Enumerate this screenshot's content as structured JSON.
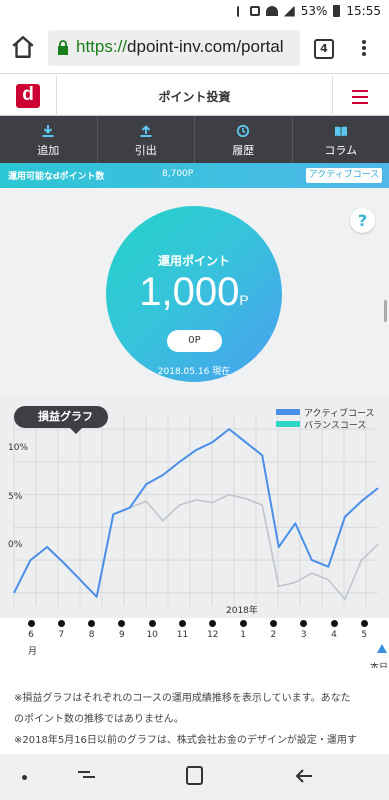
{
  "status_bar": {
    "battery": "53%",
    "time": "15:55"
  },
  "browser": {
    "url_scheme": "https://",
    "url_host": "dpoint-inv.com/portal",
    "tab_count": "4"
  },
  "app": {
    "logo": "d",
    "title": "ポイント投資",
    "brand_color": "#cc0033"
  },
  "nav": [
    {
      "label": "追加",
      "icon": "download-icon"
    },
    {
      "label": "引出",
      "icon": "upload-icon"
    },
    {
      "label": "履歴",
      "icon": "history-icon"
    },
    {
      "label": "コラム",
      "icon": "book-icon"
    }
  ],
  "points_bar": {
    "label": "運用可能なdポイント数",
    "value": "8,700P",
    "course": "アクティブコース"
  },
  "summary": {
    "label": "運用ポイント",
    "value": "1,000",
    "unit": "P",
    "change": "0P",
    "date": "2018.05.16 現在"
  },
  "graph": {
    "tag": "損益グラフ",
    "year": "2018年",
    "month_unit": "月",
    "today": "本日",
    "y_labels": [
      "10%",
      "5%",
      "0%"
    ]
  },
  "notes": {
    "line1": "※損益グラフはそれぞれのコースの運用成績推移を表示しています。あなた",
    "line2": "のポイント数の推移ではありません。",
    "line3": "※2018年5月16日以前のグラフは、株式会社お金のデザインが設定・運用す"
  },
  "chart_data": {
    "type": "line",
    "title": "損益グラフ",
    "ylabel": "",
    "xlabel": "2018年",
    "ylim": [
      -3.5,
      11
    ],
    "categories": [
      "6",
      "7",
      "8",
      "9",
      "10",
      "11",
      "12",
      "1",
      "2",
      "3",
      "4",
      "5"
    ],
    "series": [
      {
        "name": "アクティブコース",
        "color": "#4a8fe7",
        "values": [
          -2.5,
          0,
          1,
          -0.2,
          -1.5,
          -2.8,
          3.5,
          4,
          5.8,
          6.5,
          7.5,
          8.4,
          9,
          10,
          9,
          8,
          1,
          2.8,
          0,
          -0.5,
          3.3,
          4.5,
          5.5
        ]
      },
      {
        "name": "バランスコース",
        "color": "#2ed6c5",
        "values": [
          -2.5,
          0,
          1,
          -0.2,
          -1.5,
          -2.8,
          3.5,
          4,
          4.5,
          3,
          4.2,
          4.6,
          4.4,
          5,
          4.7,
          4.2,
          -2,
          -1.7,
          -1,
          -1.5,
          -3,
          0,
          1.2
        ]
      }
    ]
  }
}
